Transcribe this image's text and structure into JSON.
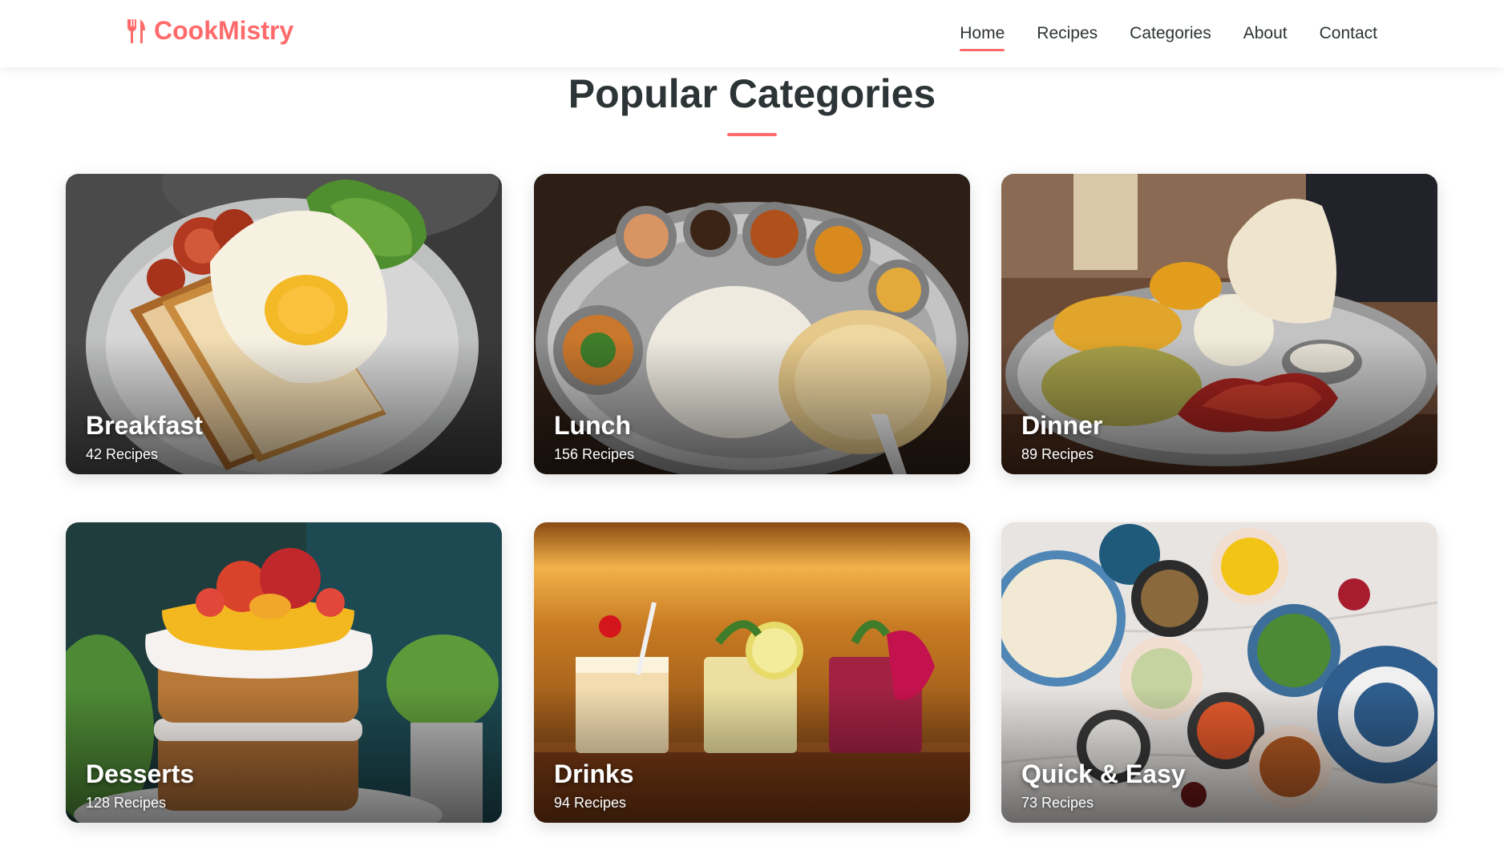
{
  "brand": {
    "name": "CookMistry",
    "logo_icon": "fork-knife-icon",
    "accent": "#ff6b6b"
  },
  "nav": {
    "items": [
      {
        "label": "Home",
        "active": true
      },
      {
        "label": "Recipes",
        "active": false
      },
      {
        "label": "Categories",
        "active": false
      },
      {
        "label": "About",
        "active": false
      },
      {
        "label": "Contact",
        "active": false
      }
    ]
  },
  "section": {
    "title": "Popular Categories"
  },
  "categories": [
    {
      "name": "Breakfast",
      "count": "42 Recipes"
    },
    {
      "name": "Lunch",
      "count": "156 Recipes"
    },
    {
      "name": "Dinner",
      "count": "89 Recipes"
    },
    {
      "name": "Desserts",
      "count": "128 Recipes"
    },
    {
      "name": "Drinks",
      "count": "94 Recipes"
    },
    {
      "name": "Quick & Easy",
      "count": "73 Recipes"
    }
  ]
}
